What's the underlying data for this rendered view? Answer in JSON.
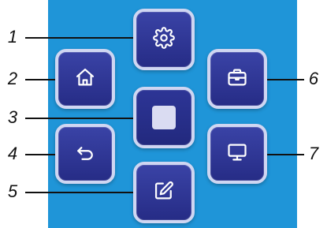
{
  "colors": {
    "panel_background": "#1f95d8",
    "button_fill": "#2b3290",
    "button_border": "#cfd6f2",
    "icon_color": "#ffffff"
  },
  "buttons": [
    {
      "id": "settings",
      "icon": "gear-icon"
    },
    {
      "id": "home",
      "icon": "home-icon"
    },
    {
      "id": "center",
      "icon": "stop-square-icon"
    },
    {
      "id": "back",
      "icon": "return-arrow-icon"
    },
    {
      "id": "edit",
      "icon": "edit-pencil-icon"
    },
    {
      "id": "toolbox",
      "icon": "briefcase-icon"
    },
    {
      "id": "display",
      "icon": "monitor-icon"
    }
  ],
  "callouts": {
    "c1": "1",
    "c2": "2",
    "c3": "3",
    "c4": "4",
    "c5": "5",
    "c6": "6",
    "c7": "7"
  }
}
